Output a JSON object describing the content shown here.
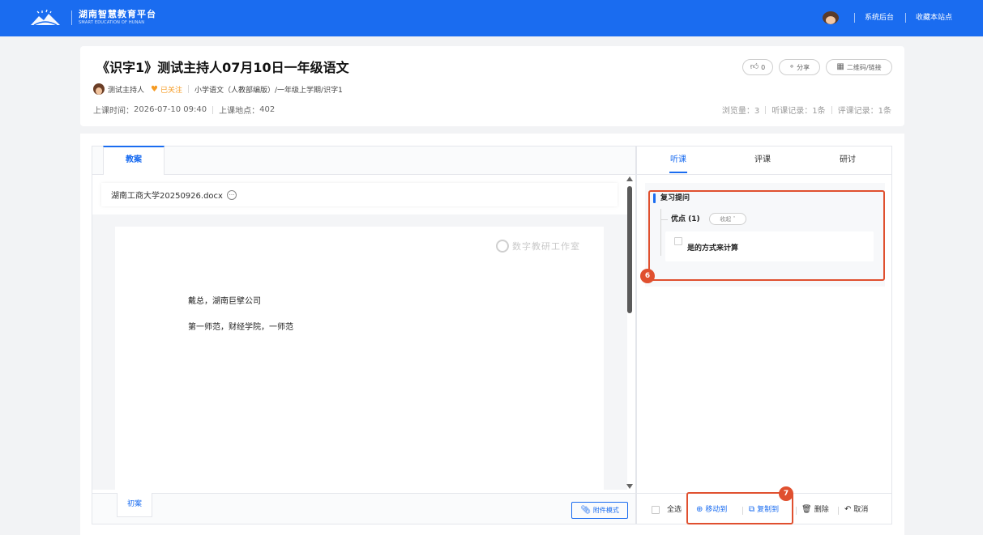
{
  "header": {
    "brand_cn": "湖南智慧教育平台",
    "brand_en": "SMART EDUCATION OF HUNAN",
    "links": [
      "系统后台",
      "收藏本站点"
    ],
    "color": "#1a6cf0"
  },
  "lesson": {
    "title": "《识字1》测试主持人07月10日一年级语文",
    "host": "测试主持人",
    "follow_status": "已关注",
    "subject_path": "小学语文（人教部编版）/一年级上学期/识字1",
    "time_label": "上课时间：",
    "time_value": "2026-07-10 09:40",
    "place_label": "上课地点：",
    "place_value": "402",
    "stats": {
      "views": "浏览量：3",
      "listen_records": "听课记录：1条",
      "review_records": "评课记录：1条"
    },
    "actions": {
      "like_count": "0",
      "share": "分享",
      "qrcode": "二维码/链接"
    }
  },
  "left_panel": {
    "tab": "教案",
    "file_name": "湖南工商大学20250926.docx",
    "file_more": "···",
    "watermark": "数字教研工作室",
    "doc_lines": [
      "戴总，湖南巨擘公司",
      "第一师范，财经学院，一师范"
    ],
    "draft_tab": "初案",
    "attach_mode": "附件模式"
  },
  "right_panel": {
    "tabs": [
      "听课",
      "评课",
      "研讨"
    ],
    "active_tab": "听课",
    "section_title": "复习提问",
    "advantage_label": "优点 (1)",
    "collapse_label": "收起",
    "items": [
      "是的方式来计算"
    ],
    "callouts": [
      "6",
      "7"
    ],
    "bottom_actions": {
      "select_all": "全选",
      "move_to": "移动到",
      "copy_to": "复制到",
      "delete": "删除",
      "cancel": "取消"
    }
  },
  "colors": {
    "accent": "#1a6cf0",
    "highlight": "#e0502f",
    "follow": "#f59b23"
  }
}
